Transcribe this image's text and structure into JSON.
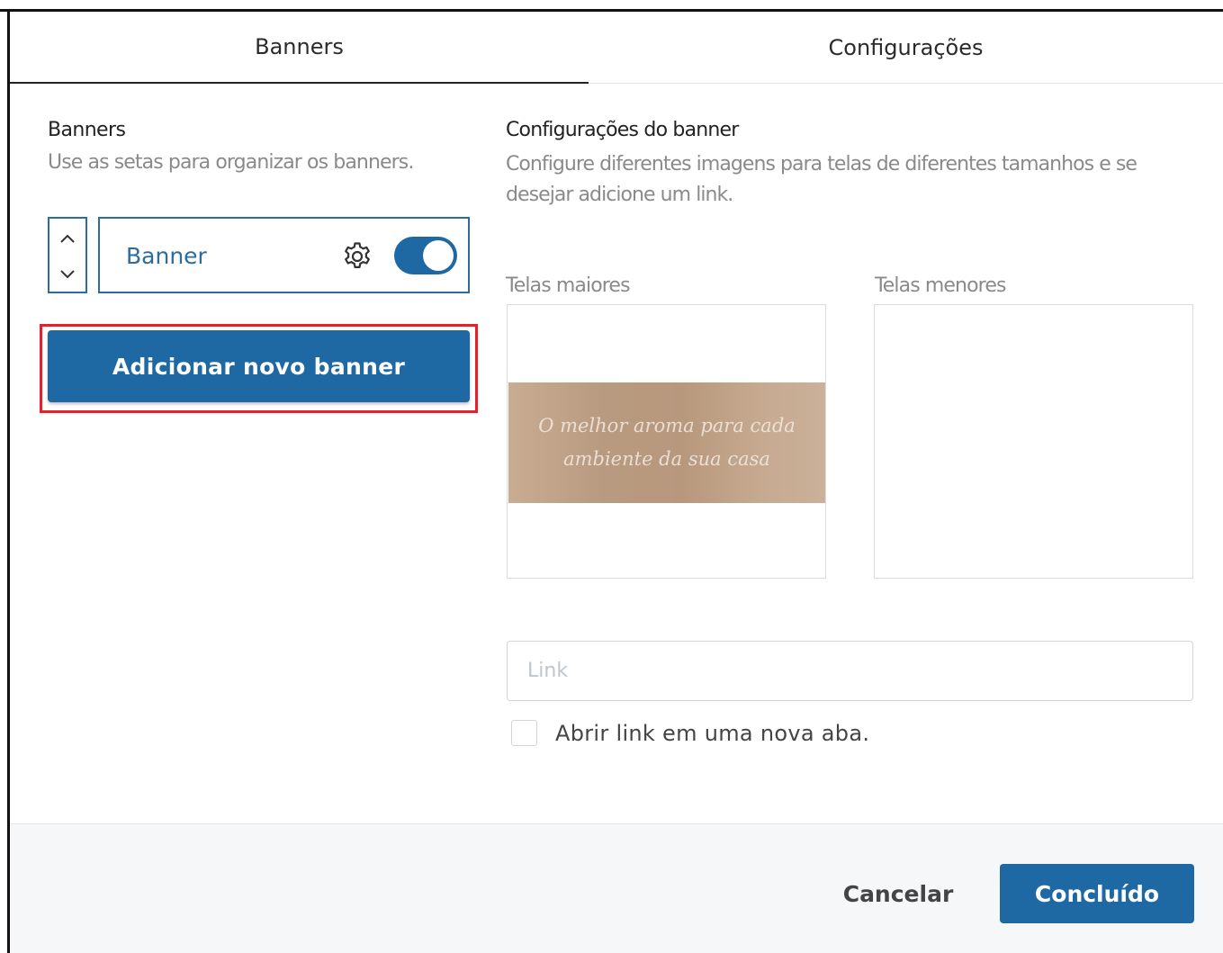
{
  "tabs": {
    "banners": "Banners",
    "configuracoes": "Configurações"
  },
  "left": {
    "title": "Banners",
    "subtitle": "Use as setas para organizar os banners.",
    "banner_item": {
      "label": "Banner",
      "enabled": true
    },
    "add_button": "Adicionar novo banner"
  },
  "right": {
    "title": "Configurações do banner",
    "subtitle": "Configure diferentes imagens para telas de diferentes tamanhos e se desejar adicione um link.",
    "label_large": "Telas maiores",
    "label_small": "Telas menores",
    "banner_image_text": "O melhor aroma para cada ambiente da sua casa",
    "link_placeholder": "Link",
    "link_value": "",
    "open_new_tab_label": "Abrir link em uma nova aba.",
    "open_new_tab_checked": false
  },
  "footer": {
    "cancel": "Cancelar",
    "done": "Concluído"
  },
  "colors": {
    "primary": "#1e69a4",
    "highlight": "#e5202b"
  },
  "icons": {
    "up": "chevron-up-icon",
    "down": "chevron-down-icon",
    "settings": "gear-icon"
  }
}
